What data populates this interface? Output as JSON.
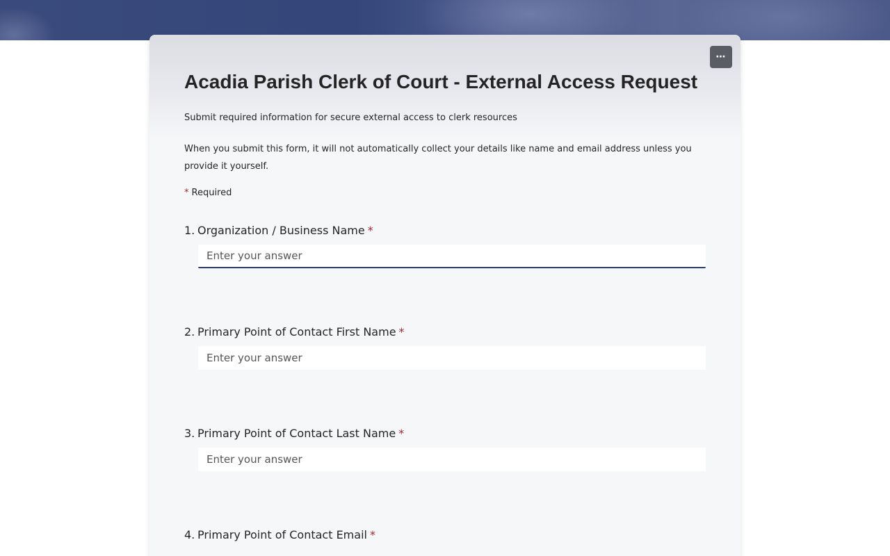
{
  "form": {
    "title": "Acadia Parish Clerk of Court - External Access Request",
    "subtitle": "Submit required information for secure external access to clerk resources",
    "privacy_notice": "When you submit this form, it will not automatically collect your details like name and email address unless you provide it yourself.",
    "required_star": "*",
    "required_label": "Required",
    "more_label": "⋯"
  },
  "questions": [
    {
      "number": "1.",
      "label": "Organization / Business Name",
      "star": "*",
      "placeholder": "Enter your answer",
      "value": ""
    },
    {
      "number": "2.",
      "label": "Primary Point of Contact First Name",
      "star": "*",
      "placeholder": "Enter your answer",
      "value": ""
    },
    {
      "number": "3.",
      "label": "Primary Point of Contact Last Name",
      "star": "*",
      "placeholder": "Enter your answer",
      "value": ""
    },
    {
      "number": "4.",
      "label": "Primary Point of Contact Email",
      "star": "*"
    }
  ],
  "colors": {
    "banner": "#3a4a7c",
    "card_bg": "#f6f7f9",
    "required_star": "#a4262c",
    "focus_underline": "#2b3a67",
    "more_button": "#5a5d66"
  }
}
